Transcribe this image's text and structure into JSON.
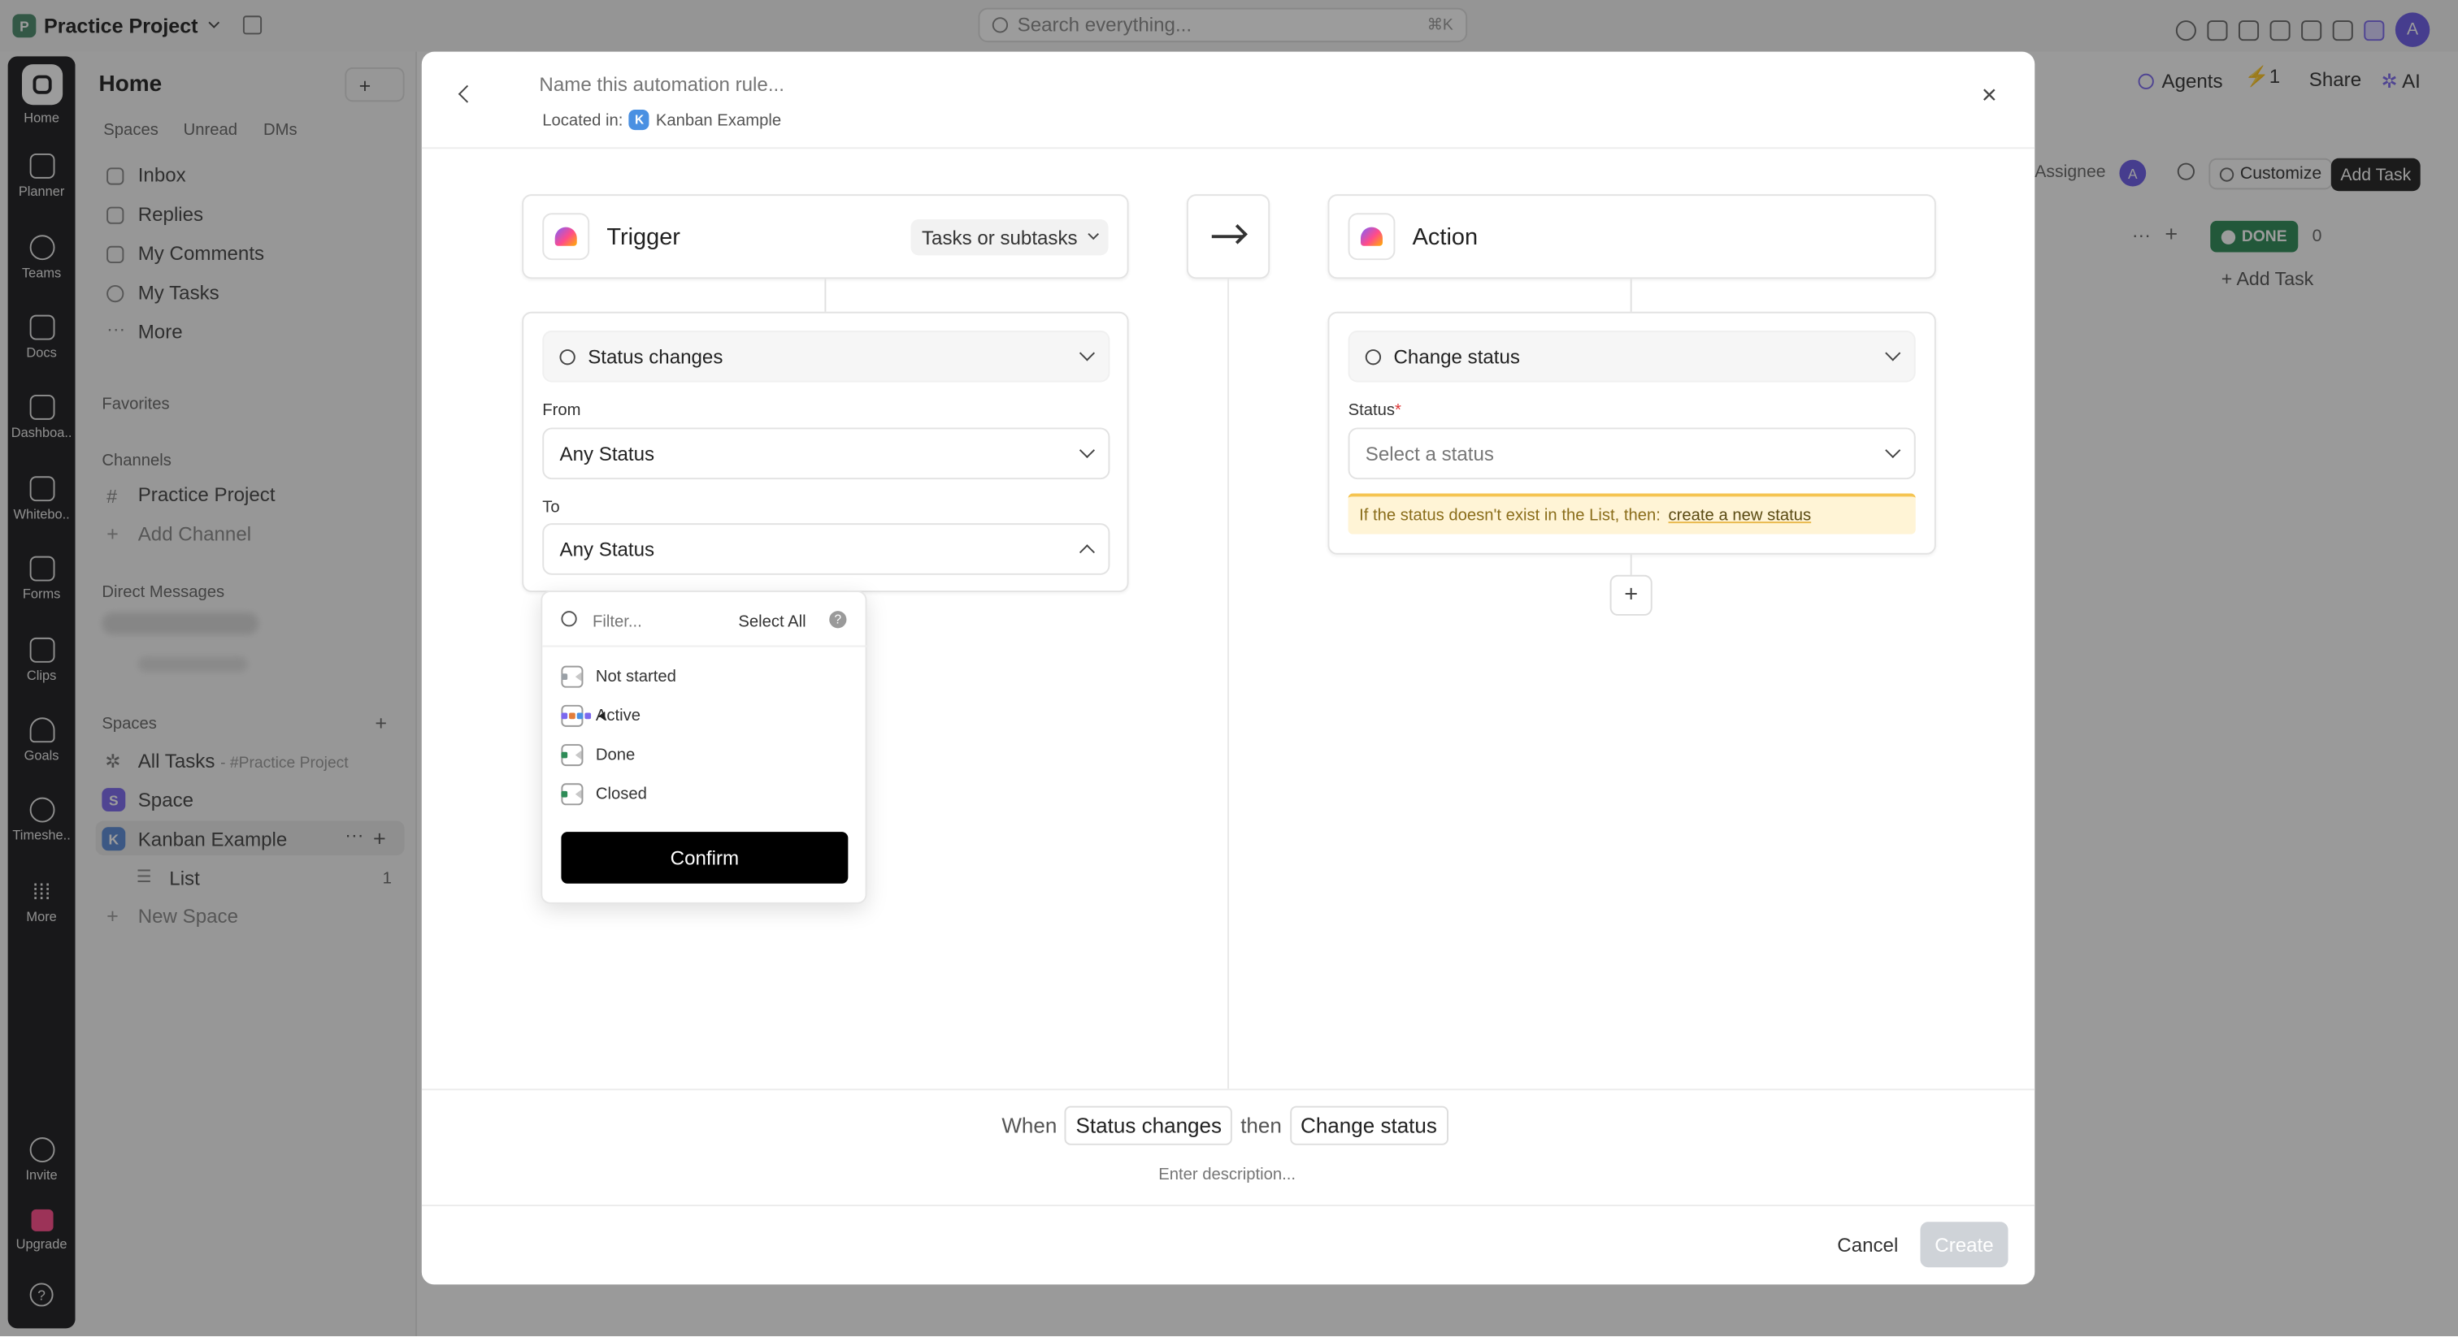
{
  "topbar": {
    "project_badge": "P",
    "project_name": "Practice Project",
    "search_placeholder": "Search everything...",
    "search_shortcut": "⌘K",
    "avatar": "A"
  },
  "rail": {
    "items": [
      "Home",
      "Planner",
      "Teams",
      "Docs",
      "Dashboa..",
      "Whitebo..",
      "Forms",
      "Clips",
      "Goals",
      "Timeshe..",
      "More"
    ],
    "invite": "Invite",
    "upgrade": "Upgrade",
    "help": "?"
  },
  "sidebar": {
    "title": "Home",
    "add_button": "+",
    "tabs": [
      "Spaces",
      "Unread",
      "DMs"
    ],
    "nav": [
      "Inbox",
      "Replies",
      "My Comments",
      "My Tasks",
      "More"
    ],
    "favorites": "Favorites",
    "channels_header": "Channels",
    "channel": "Practice Project",
    "add_channel": "Add Channel",
    "direct_messages": "Direct Messages",
    "spaces_header": "Spaces",
    "all_tasks": "All Tasks",
    "all_tasks_suffix": "- #Practice Project",
    "space_badge": "S",
    "space": "Space",
    "kanban_badge": "K",
    "kanban": "Kanban Example",
    "list": "List",
    "list_count": "1",
    "new_space": "New Space"
  },
  "board": {
    "agents": "Agents",
    "lightning_count": "1",
    "share": "Share",
    "ai": "AI",
    "assignee": "Assignee",
    "assignee_avatar": "A",
    "customize": "Customize",
    "add_task_button": "Add Task",
    "done_status": "DONE",
    "done_count": "0",
    "add_task_link": "+ Add Task"
  },
  "modal": {
    "name_placeholder": "Name this automation rule...",
    "located_in_label": "Located in:",
    "location_badge": "K",
    "location": "Kanban Example",
    "trigger": {
      "title": "Trigger",
      "scope": "Tasks or subtasks",
      "event": "Status changes",
      "from_label": "From",
      "from_value": "Any Status",
      "to_label": "To",
      "to_value": "Any Status"
    },
    "action": {
      "title": "Action",
      "event": "Change status",
      "status_label": "Status",
      "required_mark": "*",
      "status_placeholder": "Select a status",
      "notice_text": "If the status doesn't exist in the List, then:",
      "notice_link": "create a new status"
    },
    "dropdown": {
      "filter_placeholder": "Filter...",
      "select_all": "Select All",
      "help": "?",
      "options": [
        "Not started",
        "Active",
        "Done",
        "Closed"
      ],
      "confirm": "Confirm"
    },
    "summary": {
      "when": "When",
      "trigger_chip": "Status changes",
      "then": "then",
      "action_chip": "Change status",
      "description_placeholder": "Enter description..."
    },
    "footer": {
      "cancel": "Cancel",
      "create": "Create"
    }
  },
  "colors": {
    "accent_purple": "#7b68ee",
    "done_green": "#2e8b57",
    "notice_bg": "#fff4d6",
    "notice_border": "#f5c451",
    "confirm_bg": "#000000",
    "create_disabled": "#cfd3d8"
  }
}
